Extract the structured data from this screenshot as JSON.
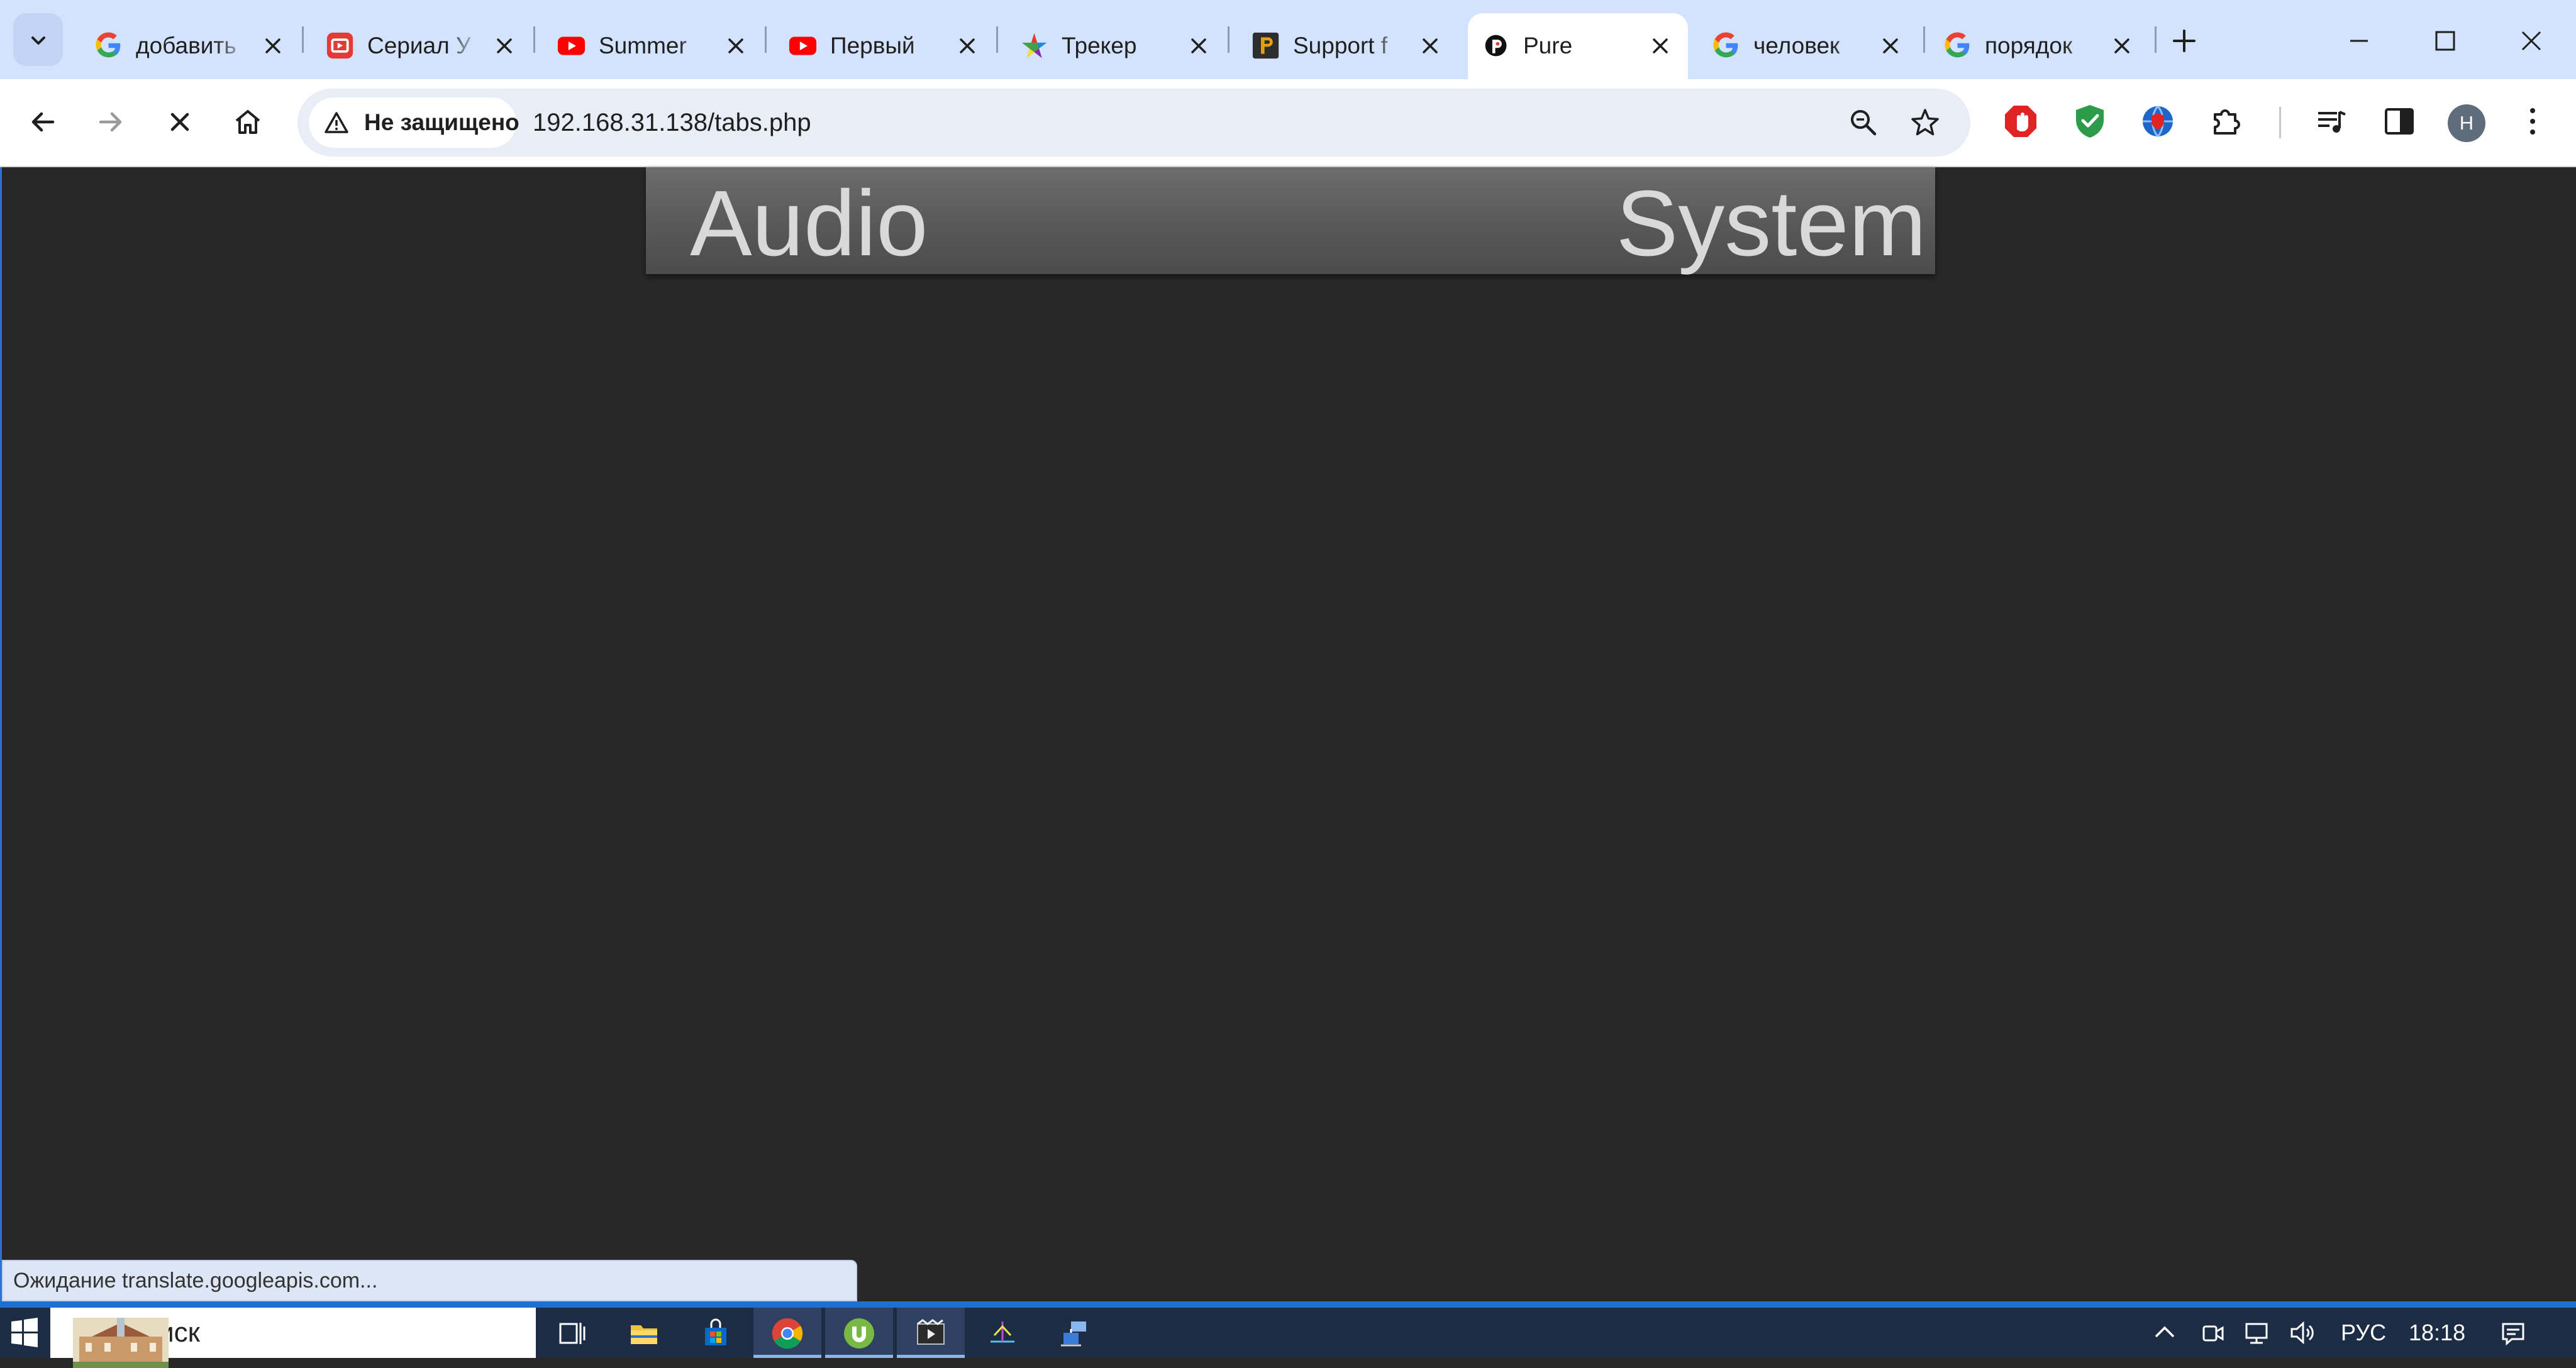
{
  "browser": {
    "tabs": [
      {
        "title": "добавить",
        "favicon": "google-icon"
      },
      {
        "title": "Сериал У",
        "favicon": "youtube-tv-icon"
      },
      {
        "title": "Summer",
        "favicon": "youtube-icon"
      },
      {
        "title": "Первый",
        "favicon": "youtube-icon"
      },
      {
        "title": "Трекер",
        "favicon": "tracker-icon"
      },
      {
        "title": "Support f",
        "favicon": "plex-icon"
      },
      {
        "title": "Pure",
        "favicon": "pure-icon",
        "active": true
      },
      {
        "title": "человек",
        "favicon": "google-icon"
      },
      {
        "title": "порядок",
        "favicon": "google-icon"
      }
    ],
    "toolbar": {
      "security_label": "Не защищено",
      "url": "192.168.31.138/tabs.php",
      "profile_initial": "H"
    },
    "status_bubble": "Ожидание translate.googleapis.com..."
  },
  "page": {
    "header_left": "Audio",
    "header_right": "System"
  },
  "taskbar": {
    "search_label": "Поиск",
    "language": "РУС",
    "time": "18:18"
  },
  "colors": {
    "tabstrip": "#d3e3fd",
    "page_background": "#282828",
    "header_text": "#d9d9d9",
    "taskbar": "#1c2c44"
  }
}
